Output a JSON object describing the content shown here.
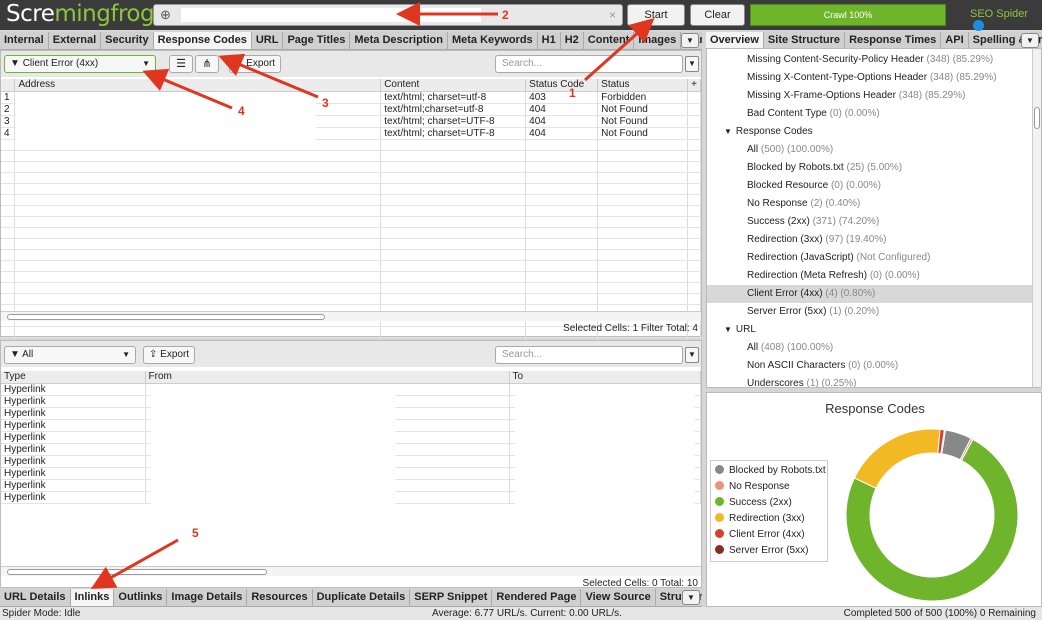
{
  "app": {
    "logo_a": "Scre",
    "logo_b": "ming",
    "logo_c": "frog",
    "start_label": "Start",
    "clear_label": "Clear",
    "crawl_label": "Crawl 100%",
    "seo_label": "SEO Spider"
  },
  "url_bar": {
    "value": "",
    "clear_symbol": "×"
  },
  "tabs_top": [
    "Internal",
    "External",
    "Security",
    "Response Codes",
    "URL",
    "Page Titles",
    "Meta Description",
    "Meta Keywords",
    "H1",
    "H2",
    "Content",
    "Images",
    "Canonicals"
  ],
  "top_panel": {
    "filter": "Client Error (4xx)",
    "export_label": "Export",
    "search_placeholder": "Search...",
    "columns": [
      "Address",
      "Content",
      "Status Code",
      "Status"
    ],
    "rows": [
      {
        "n": "1",
        "address": "",
        "content": "text/html; charset=utf-8",
        "code": "403",
        "status": "Forbidden"
      },
      {
        "n": "2",
        "address": "",
        "content": "text/html;charset=utf-8",
        "code": "404",
        "status": "Not Found"
      },
      {
        "n": "3",
        "address": "",
        "content": "text/html; charset=UTF-8",
        "code": "404",
        "status": "Not Found"
      },
      {
        "n": "4",
        "address": "",
        "content": "text/html; charset=UTF-8",
        "code": "404",
        "status": "Not Found"
      }
    ],
    "status_text": "Selected Cells: 1  Filter Total: 4"
  },
  "bottom_panel": {
    "filter": "All",
    "export_label": "Export",
    "search_placeholder": "Search...",
    "columns": [
      "Type",
      "From",
      "To"
    ],
    "rows": [
      "Hyperlink",
      "Hyperlink",
      "Hyperlink",
      "Hyperlink",
      "Hyperlink",
      "Hyperlink",
      "Hyperlink",
      "Hyperlink",
      "Hyperlink",
      "Hyperlink"
    ],
    "status_text": "Selected Cells: 0  Total: 10"
  },
  "tabs_bottom": [
    "URL Details",
    "Inlinks",
    "Outlinks",
    "Image Details",
    "Resources",
    "Duplicate Details",
    "SERP Snippet",
    "Rendered Page",
    "View Source",
    "Structured Data Det"
  ],
  "tabs_right": [
    "Overview",
    "Site Structure",
    "Response Times",
    "API",
    "Spelling & Gran"
  ],
  "tree": [
    {
      "label": "Missing Content-Security-Policy Header",
      "count": "(348) (85.29%)"
    },
    {
      "label": "Missing X-Content-Type-Options Header",
      "count": "(348) (85.29%)"
    },
    {
      "label": "Missing X-Frame-Options Header",
      "count": "(348) (85.29%)"
    },
    {
      "label": "Bad Content Type",
      "count": "(0) (0.00%)"
    },
    {
      "label": "Response Codes",
      "count": "",
      "header": true
    },
    {
      "label": "All",
      "count": "(500) (100.00%)"
    },
    {
      "label": "Blocked by Robots.txt",
      "count": "(25) (5.00%)"
    },
    {
      "label": "Blocked Resource",
      "count": "(0) (0.00%)"
    },
    {
      "label": "No Response",
      "count": "(2) (0.40%)"
    },
    {
      "label": "Success (2xx)",
      "count": "(371) (74.20%)"
    },
    {
      "label": "Redirection (3xx)",
      "count": "(97) (19.40%)"
    },
    {
      "label": "Redirection (JavaScript)",
      "count": "(Not Configured)"
    },
    {
      "label": "Redirection (Meta Refresh)",
      "count": "(0) (0.00%)"
    },
    {
      "label": "Client Error (4xx)",
      "count": "(4) (0.80%)",
      "selected": true
    },
    {
      "label": "Server Error (5xx)",
      "count": "(1) (0.20%)"
    },
    {
      "label": "URL",
      "count": "",
      "header": true
    },
    {
      "label": "All",
      "count": "(408) (100.00%)"
    },
    {
      "label": "Non ASCII Characters",
      "count": "(0) (0.00%)"
    },
    {
      "label": "Underscores",
      "count": "(1) (0.25%)"
    }
  ],
  "chart": {
    "title": "Response Codes",
    "legend": [
      {
        "name": "Blocked by Robots.txt",
        "color": "#888888"
      },
      {
        "name": "No Response",
        "color": "#f0907a"
      },
      {
        "name": "Success (2xx)",
        "color": "#6fb52c"
      },
      {
        "name": "Redirection (3xx)",
        "color": "#f3b925"
      },
      {
        "name": "Client Error (4xx)",
        "color": "#d9402b"
      },
      {
        "name": "Server Error (5xx)",
        "color": "#8b2a22"
      }
    ]
  },
  "chart_data": {
    "type": "pie",
    "title": "Response Codes",
    "categories": [
      "Blocked by Robots.txt",
      "No Response",
      "Success (2xx)",
      "Redirection (3xx)",
      "Client Error (4xx)",
      "Server Error (5xx)"
    ],
    "values": [
      25,
      2,
      371,
      97,
      4,
      1
    ]
  },
  "footer": {
    "mode": "Spider Mode: Idle",
    "average": "Average: 6.77 URL/s. Current: 0.00 URL/s.",
    "completed": "Completed 500 of 500 (100%) 0 Remaining"
  },
  "annotations": [
    "1",
    "2",
    "3",
    "4",
    "5"
  ]
}
